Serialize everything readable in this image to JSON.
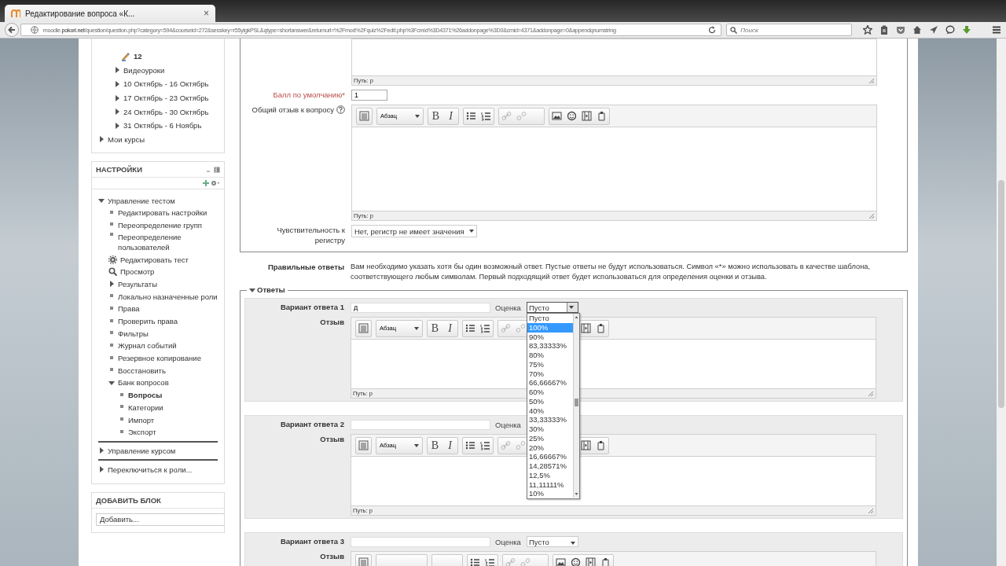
{
  "browser": {
    "tab_title": "Редактирование вопроса «К...",
    "tab_close": "×",
    "url": "moodle.**pokori.net**/question/question.php?category=594&courseid=272&sesskey=r55ylgkPSL&qtype=shortanswer&returnurl=%2Fmod%2Fquiz%2Fedit.php%3Fcmid%3D4371%26addonpage%3D0&cmid=4371&addonpage=0&appendqnumstring",
    "search_placeholder": "Поиск"
  },
  "navigation": {
    "items": [
      {
        "label": "12",
        "kind": "quiz"
      },
      {
        "label": "Видеоуроки",
        "kind": "branch",
        "expanded": false
      },
      {
        "label": "10 Октябрь - 16 Октябрь",
        "kind": "branch",
        "expanded": false
      },
      {
        "label": "17 Октябрь - 23 Октябрь",
        "kind": "branch",
        "expanded": false
      },
      {
        "label": "24 Октябрь - 30 Октябрь",
        "kind": "branch",
        "expanded": false
      },
      {
        "label": "31 Октябрь - 6 Ноябрь",
        "kind": "branch",
        "expanded": false
      }
    ],
    "root_items": [
      {
        "label": "Мои курсы",
        "kind": "branch",
        "expanded": false
      }
    ]
  },
  "settings": {
    "title": "НАСТРОЙКИ",
    "items": [
      {
        "label": "Управление тестом",
        "kind": "branch",
        "expanded": true,
        "children": [
          {
            "label": "Редактировать настройки",
            "kind": "leaf"
          },
          {
            "label": "Переопределение групп",
            "kind": "leaf"
          },
          {
            "label": "Переопределение пользователей",
            "kind": "leaf"
          },
          {
            "label": "Редактировать тест",
            "kind": "gear"
          },
          {
            "label": "Просмотр",
            "kind": "search"
          },
          {
            "label": "Результаты",
            "kind": "branch",
            "expanded": false
          },
          {
            "label": "Локально назначенные роли",
            "kind": "leaf"
          },
          {
            "label": "Права",
            "kind": "leaf"
          },
          {
            "label": "Проверить права",
            "kind": "leaf"
          },
          {
            "label": "Фильтры",
            "kind": "leaf"
          },
          {
            "label": "Журнал событий",
            "kind": "leaf"
          },
          {
            "label": "Резервное копирование",
            "kind": "leaf"
          },
          {
            "label": "Восстановить",
            "kind": "leaf"
          },
          {
            "label": "Банк вопросов",
            "kind": "branch",
            "expanded": true,
            "children": [
              {
                "label": "Вопросы",
                "kind": "leaf",
                "current": true
              },
              {
                "label": "Категории",
                "kind": "leaf",
                "current": false
              },
              {
                "label": "Импорт",
                "kind": "leaf",
                "current": false
              },
              {
                "label": "Экспорт",
                "kind": "leaf",
                "current": false
              }
            ]
          }
        ]
      },
      {
        "label": "Управление курсом",
        "kind": "branch",
        "expanded": false
      },
      {
        "label": "Переключиться к роли...",
        "kind": "branch",
        "expanded": false
      }
    ]
  },
  "add_block": {
    "title": "ДОБАВИТЬ БЛОК",
    "value": "Добавить..."
  },
  "general": {
    "top_editor": {
      "path": "Путь: p"
    },
    "default_mark": {
      "label": "Балл по умолчанию*",
      "required": true,
      "value": "1"
    },
    "general_feedback": {
      "label": "Общий отзыв к вопросу",
      "editor": {
        "toolbar": true,
        "format": "Абзац",
        "bold_label": "B",
        "italic_label": "I",
        "path": "Путь: p"
      }
    },
    "case_sensitivity": {
      "label": "Чувствительность к регистру",
      "value": "Нет, регистр не имеет значения"
    }
  },
  "correct_answers": {
    "label": "Правильные ответы",
    "text": "Вам необходимо указать хотя бы один возможный ответ. Пустые ответы не будут использоваться. Символ «*» можно использовать в качестве шаблона, соответствующего любым символам. Первый подходящий ответ будет использоваться для определения оценки и отзыва."
  },
  "answers": {
    "legend": "Ответы",
    "expanded": true,
    "items": [
      {
        "label": "Вариант ответа 1",
        "value": "д",
        "grade_label": "Оценка",
        "grade": "Пусто",
        "grade_open": true,
        "grade_options": [
          {
            "label": "Пусто",
            "selected": false
          },
          {
            "label": "100%",
            "selected": true
          },
          {
            "label": "90%",
            "selected": false
          },
          {
            "label": "83,33333%",
            "selected": false
          },
          {
            "label": "80%",
            "selected": false
          },
          {
            "label": "75%",
            "selected": false
          },
          {
            "label": "70%",
            "selected": false
          },
          {
            "label": "66,66667%",
            "selected": false
          },
          {
            "label": "60%",
            "selected": false
          },
          {
            "label": "50%",
            "selected": false
          },
          {
            "label": "40%",
            "selected": false
          },
          {
            "label": "33,33333%",
            "selected": false
          },
          {
            "label": "30%",
            "selected": false
          },
          {
            "label": "25%",
            "selected": false
          },
          {
            "label": "20%",
            "selected": false
          },
          {
            "label": "16,66667%",
            "selected": false
          },
          {
            "label": "14,28571%",
            "selected": false
          },
          {
            "label": "12,5%",
            "selected": false
          },
          {
            "label": "11,11111%",
            "selected": false
          },
          {
            "label": "10%",
            "selected": false
          }
        ],
        "feedback_label": "Отзыв",
        "editor": {
          "toolbar": true,
          "format": "Абзац",
          "bold_label": "B",
          "italic_label": "I",
          "path": "Путь: p"
        }
      },
      {
        "label": "Вариант ответа 2",
        "grade_label": "Оценка",
        "feedback_label": "Отзыв",
        "editor": {
          "toolbar": true,
          "format": "Абзац",
          "bold_label": "B",
          "italic_label": "I",
          "path": "Путь: p"
        }
      },
      {
        "label": "Вариант ответа 3",
        "grade_label": "Оценка",
        "grade": "Пусто",
        "grade_open": false,
        "feedback_label": "Отзыв",
        "editor": {
          "toolbar": true
        }
      }
    ]
  }
}
